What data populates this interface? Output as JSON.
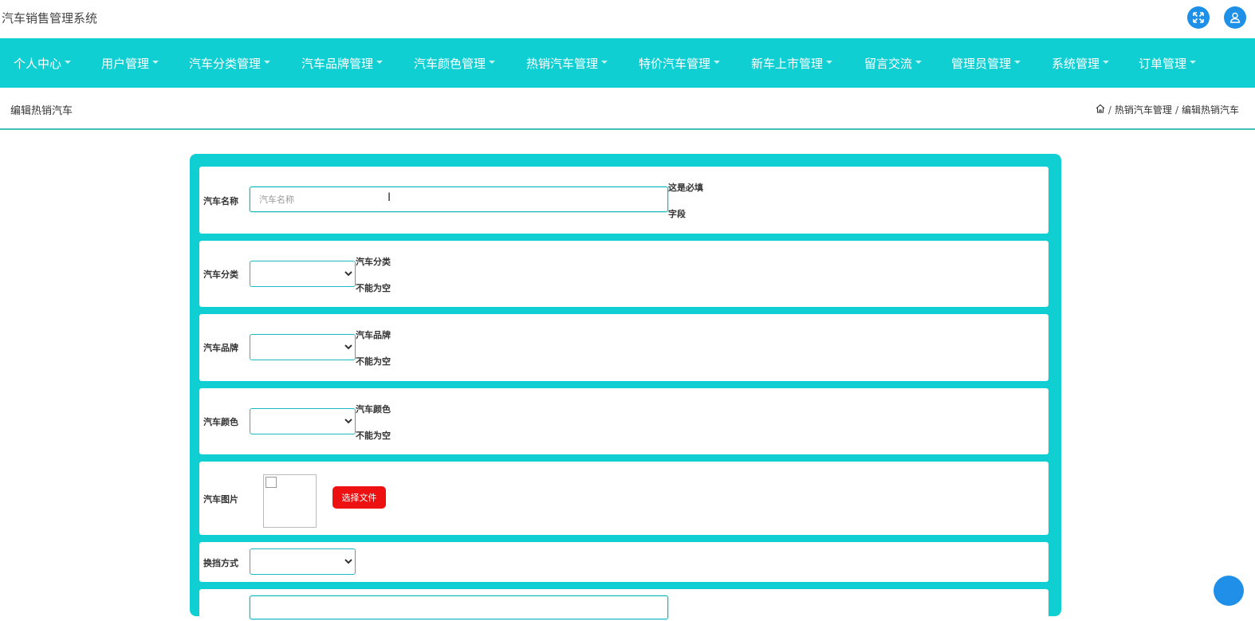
{
  "app": {
    "title": "汽车销售管理系统"
  },
  "header_icons": [
    "expand-icon",
    "user-icon"
  ],
  "nav": {
    "items": [
      {
        "label": "个人中心"
      },
      {
        "label": "用户管理"
      },
      {
        "label": "汽车分类管理"
      },
      {
        "label": "汽车品牌管理"
      },
      {
        "label": "汽车颜色管理"
      },
      {
        "label": "热销汽车管理"
      },
      {
        "label": "特价汽车管理"
      },
      {
        "label": "新车上市管理"
      },
      {
        "label": "留言交流"
      },
      {
        "label": "管理员管理"
      },
      {
        "label": "系统管理"
      },
      {
        "label": "订单管理"
      }
    ]
  },
  "page": {
    "title": "编辑热销汽车",
    "breadcrumb": [
      "热销汽车管理",
      "编辑热销汽车"
    ]
  },
  "form": {
    "car_name": {
      "label": "汽车名称",
      "placeholder": "汽车名称",
      "value": "",
      "hint_line1": "这是必填",
      "hint_line2": "字段"
    },
    "category": {
      "label": "汽车分类",
      "selected": "",
      "hint_line1": "汽车分类",
      "hint_line2": "不能为空"
    },
    "brand": {
      "label": "汽车品牌",
      "selected": "",
      "hint_line1": "汽车品牌",
      "hint_line2": "不能为空"
    },
    "color": {
      "label": "汽车颜色",
      "selected": "",
      "hint_line1": "汽车颜色",
      "hint_line2": "不能为空"
    },
    "image": {
      "label": "汽车图片",
      "button": "选择文件"
    },
    "gearbox": {
      "label": "换挡方式",
      "selected": ""
    }
  },
  "colors": {
    "accent": "#0fcfd3",
    "button_red": "#ee1111",
    "icon_blue": "#1e90e8"
  }
}
